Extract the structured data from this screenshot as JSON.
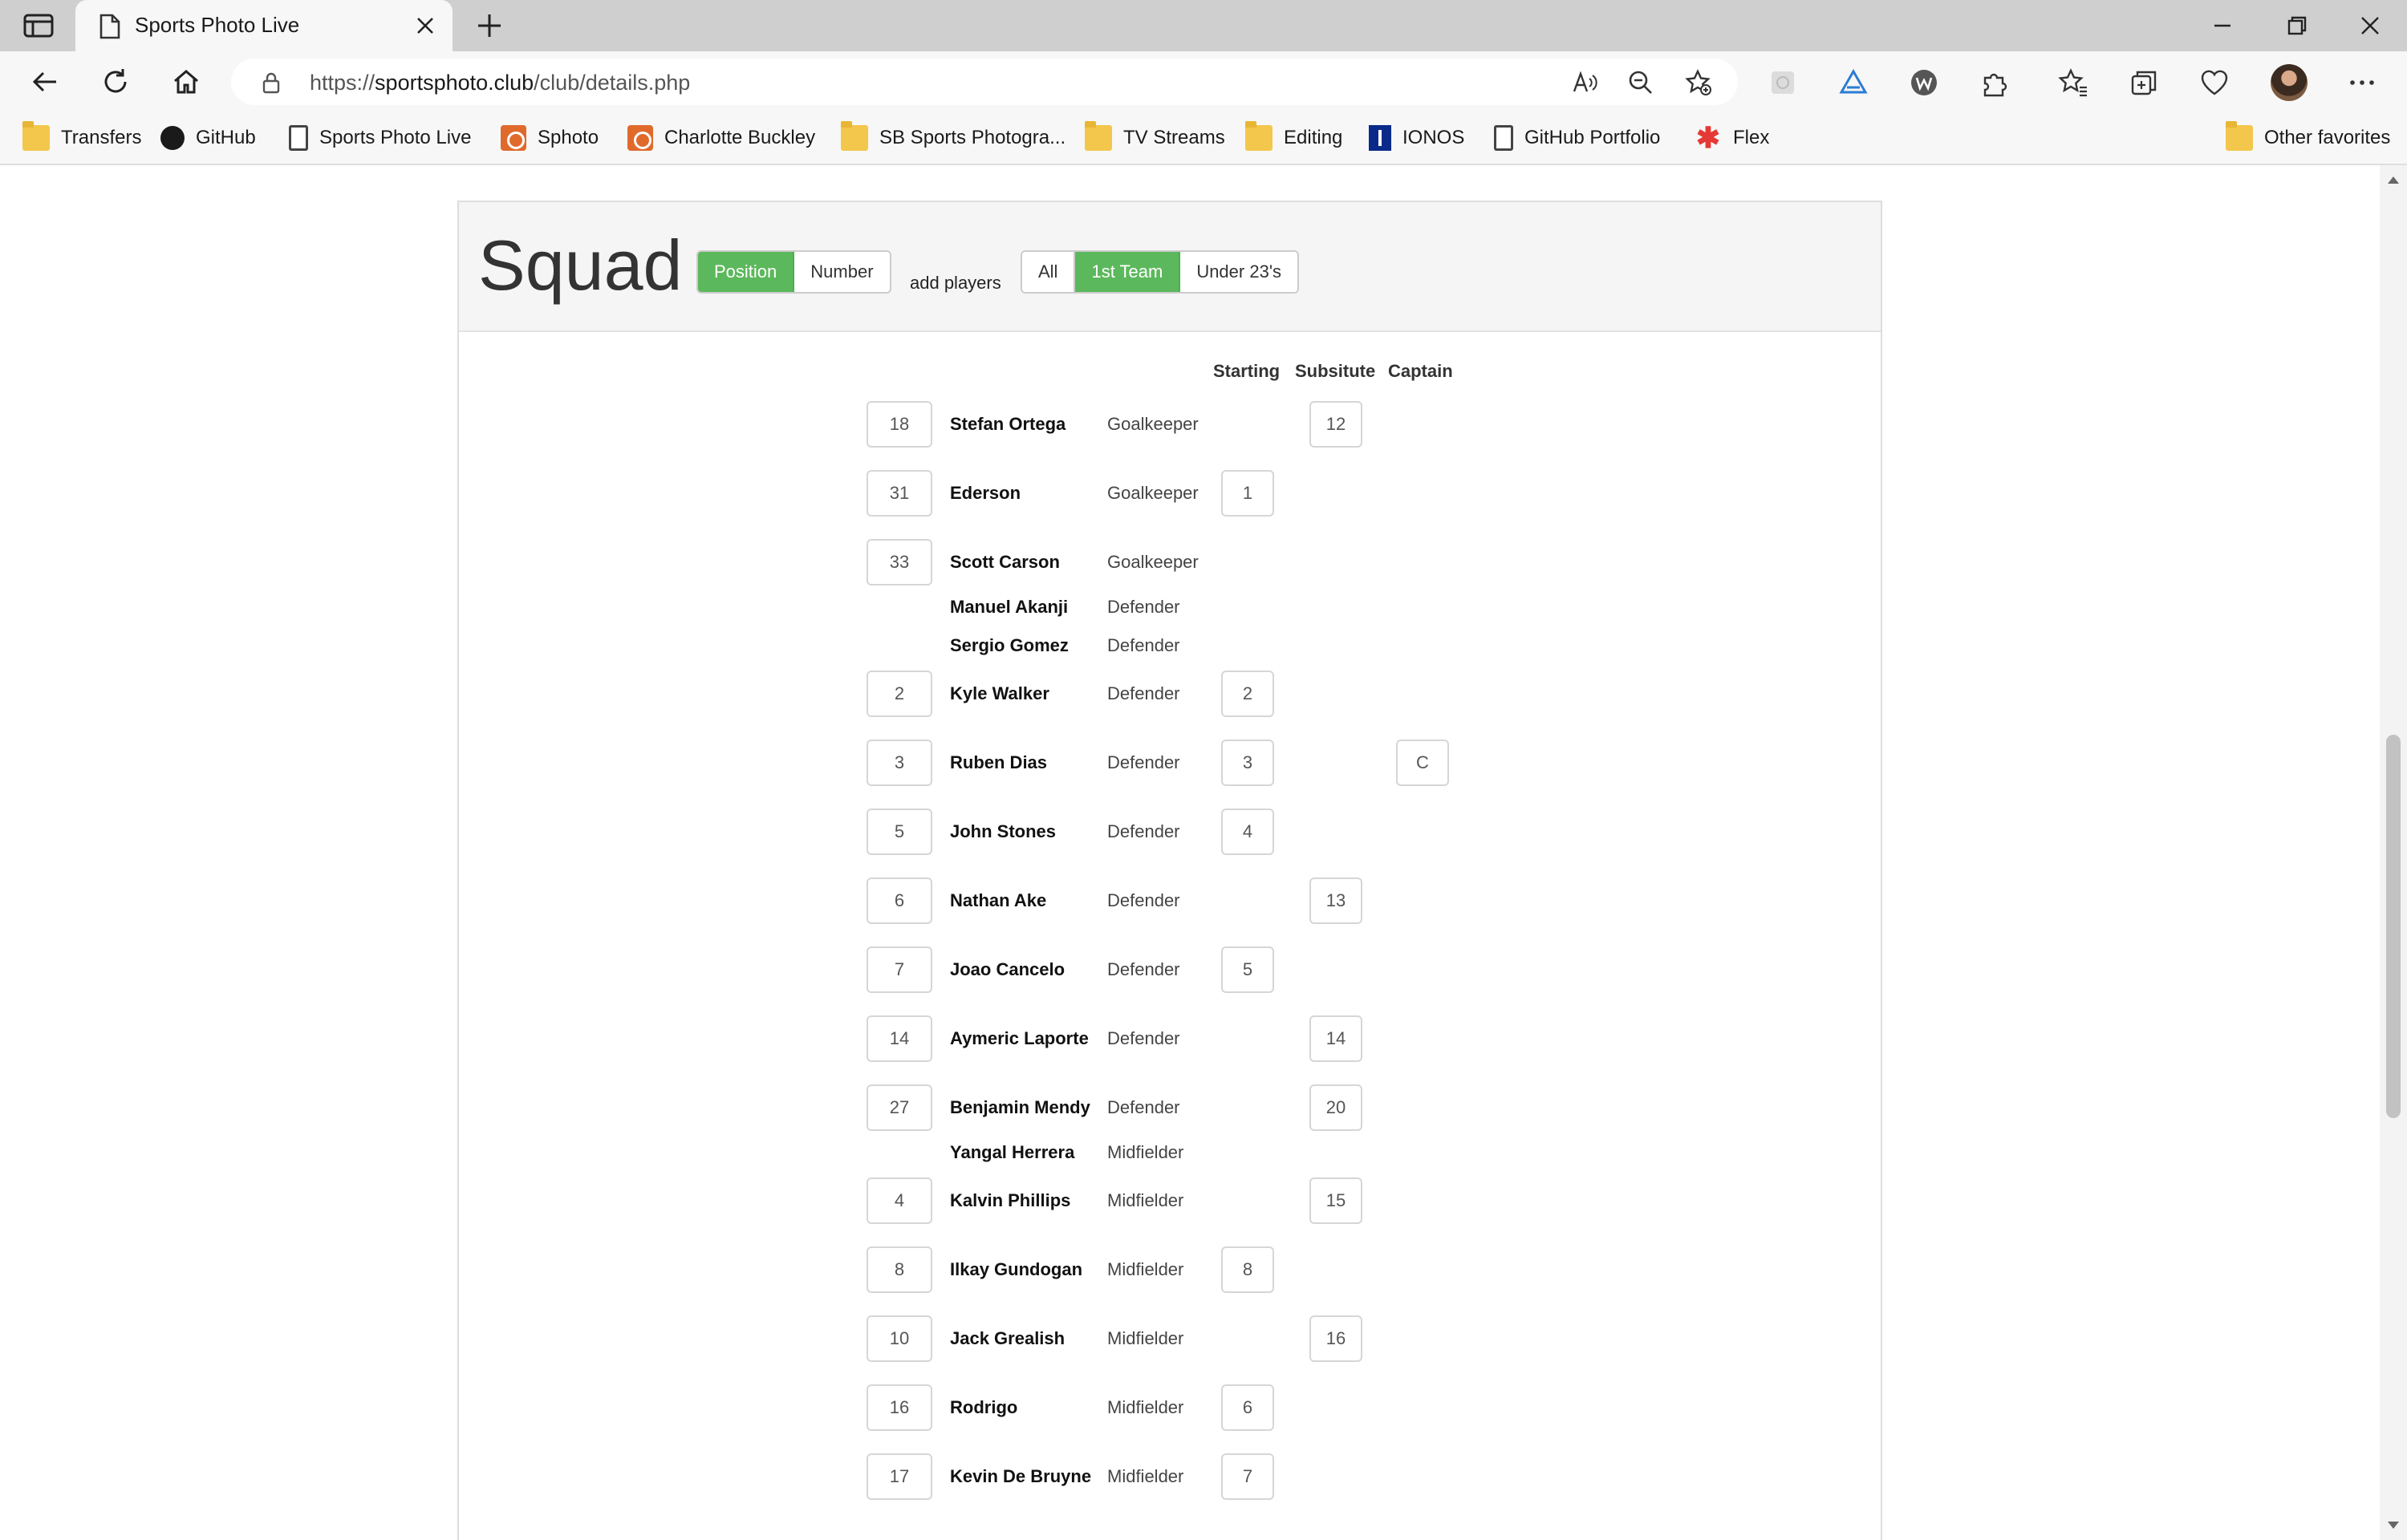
{
  "browser": {
    "tab_title": "Sports Photo Live",
    "url_prefix": "https://",
    "url_host": "sportsphoto.club",
    "url_path": "/club/details.php",
    "favorites": [
      {
        "label": "Transfers",
        "icon": "folder-icon"
      },
      {
        "label": "GitHub",
        "icon": "github-icon"
      },
      {
        "label": "Sports Photo Live",
        "icon": "page-icon"
      },
      {
        "label": "Sphoto",
        "icon": "sphoto-icon"
      },
      {
        "label": "Charlotte Buckley",
        "icon": "sphoto-icon"
      },
      {
        "label": "SB Sports Photogra...",
        "icon": "folder-icon"
      },
      {
        "label": "TV Streams",
        "icon": "folder-icon"
      },
      {
        "label": "Editing",
        "icon": "folder-icon"
      },
      {
        "label": "IONOS",
        "icon": "ionos-icon"
      },
      {
        "label": "GitHub Portfolio",
        "icon": "page-icon"
      },
      {
        "label": "Flex",
        "icon": "flex-icon"
      }
    ],
    "other_favorites": "Other favorites"
  },
  "squad": {
    "title": "Squad",
    "sort_buttons": [
      "Position",
      "Number"
    ],
    "sort_active": "Position",
    "add_players": "add players",
    "filter_buttons": [
      "All",
      "1st Team",
      "Under 23's"
    ],
    "filter_active": "1st Team",
    "columns": {
      "starting": "Starting",
      "substitute": "Subsitute",
      "captain": "Captain"
    },
    "players": [
      {
        "number": "18",
        "name": "Stefan Ortega",
        "position": "Goalkeeper",
        "starting": "",
        "sub": "12",
        "captain": ""
      },
      {
        "number": "31",
        "name": "Ederson",
        "position": "Goalkeeper",
        "starting": "1",
        "sub": "",
        "captain": ""
      },
      {
        "number": "33",
        "name": "Scott Carson",
        "position": "Goalkeeper",
        "starting": "",
        "sub": "",
        "captain": ""
      },
      {
        "number": "",
        "name": "Manuel Akanji",
        "position": "Defender",
        "starting": "",
        "sub": "",
        "captain": ""
      },
      {
        "number": "",
        "name": "Sergio Gomez",
        "position": "Defender",
        "starting": "",
        "sub": "",
        "captain": ""
      },
      {
        "number": "2",
        "name": "Kyle Walker",
        "position": "Defender",
        "starting": "2",
        "sub": "",
        "captain": ""
      },
      {
        "number": "3",
        "name": "Ruben Dias",
        "position": "Defender",
        "starting": "3",
        "sub": "",
        "captain": "C"
      },
      {
        "number": "5",
        "name": "John Stones",
        "position": "Defender",
        "starting": "4",
        "sub": "",
        "captain": ""
      },
      {
        "number": "6",
        "name": "Nathan Ake",
        "position": "Defender",
        "starting": "",
        "sub": "13",
        "captain": ""
      },
      {
        "number": "7",
        "name": "Joao Cancelo",
        "position": "Defender",
        "starting": "5",
        "sub": "",
        "captain": ""
      },
      {
        "number": "14",
        "name": "Aymeric Laporte",
        "position": "Defender",
        "starting": "",
        "sub": "14",
        "captain": ""
      },
      {
        "number": "27",
        "name": "Benjamin Mendy",
        "position": "Defender",
        "starting": "",
        "sub": "20",
        "captain": ""
      },
      {
        "number": "",
        "name": "Yangal Herrera",
        "position": "Midfielder",
        "starting": "",
        "sub": "",
        "captain": ""
      },
      {
        "number": "4",
        "name": "Kalvin Phillips",
        "position": "Midfielder",
        "starting": "",
        "sub": "15",
        "captain": ""
      },
      {
        "number": "8",
        "name": "Ilkay Gundogan",
        "position": "Midfielder",
        "starting": "8",
        "sub": "",
        "captain": ""
      },
      {
        "number": "10",
        "name": "Jack Grealish",
        "position": "Midfielder",
        "starting": "",
        "sub": "16",
        "captain": ""
      },
      {
        "number": "16",
        "name": "Rodrigo",
        "position": "Midfielder",
        "starting": "6",
        "sub": "",
        "captain": ""
      },
      {
        "number": "17",
        "name": "Kevin De Bruyne",
        "position": "Midfielder",
        "starting": "7",
        "sub": "",
        "captain": ""
      }
    ]
  },
  "colors": {
    "accent_green": "#5cb85c",
    "chrome": "#f7f7f7"
  }
}
